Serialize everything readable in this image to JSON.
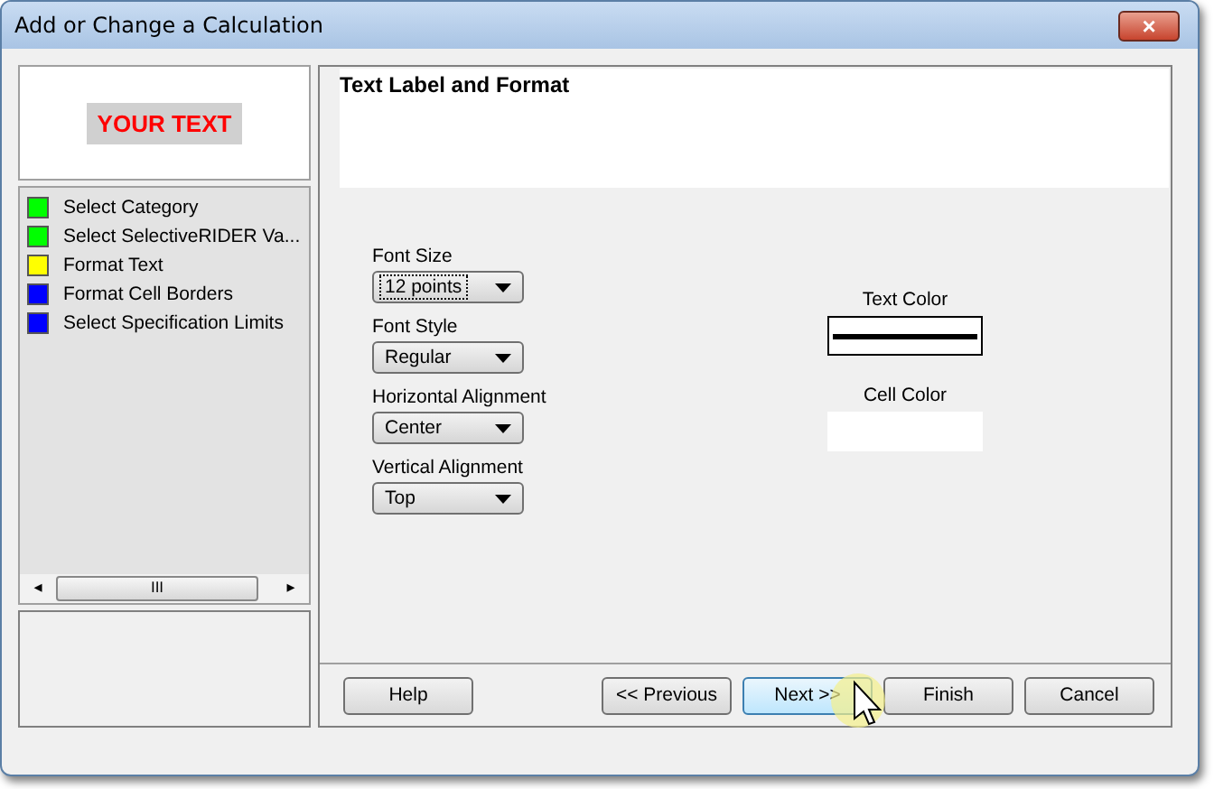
{
  "window": {
    "title": "Add or Change a Calculation",
    "close_label": "×"
  },
  "preview": {
    "text": "YOUR TEXT"
  },
  "steps": [
    {
      "label": "Select Category",
      "color": "#00ff00"
    },
    {
      "label": "Select SelectiveRIDER Va...",
      "color": "#00ff00"
    },
    {
      "label": "Format Text",
      "color": "#ffff00"
    },
    {
      "label": "Format Cell Borders",
      "color": "#0000ff"
    },
    {
      "label": "Select Specification Limits",
      "color": "#0000ff"
    }
  ],
  "scrollbar": {
    "left": "◂",
    "right": "▸",
    "grip": "III"
  },
  "header": {
    "title": "Text Label and Format"
  },
  "fields": [
    {
      "label": "Font Size",
      "value": "12 points",
      "focused": true
    },
    {
      "label": "Font Style",
      "value": "Regular",
      "focused": false
    },
    {
      "label": "Horizontal Alignment",
      "value": "Center",
      "focused": false
    },
    {
      "label": "Vertical Alignment",
      "value": "Top",
      "focused": false
    }
  ],
  "colors": [
    {
      "label": "Text Color",
      "kind": "line"
    },
    {
      "label": "Cell Color",
      "kind": "blank"
    }
  ],
  "buttons": [
    {
      "label": "Help",
      "focused": false
    },
    {
      "label": "<< Previous",
      "focused": false
    },
    {
      "label": "Next >>",
      "focused": true
    },
    {
      "label": "Finish",
      "focused": false
    },
    {
      "label": "Cancel",
      "focused": false
    }
  ]
}
